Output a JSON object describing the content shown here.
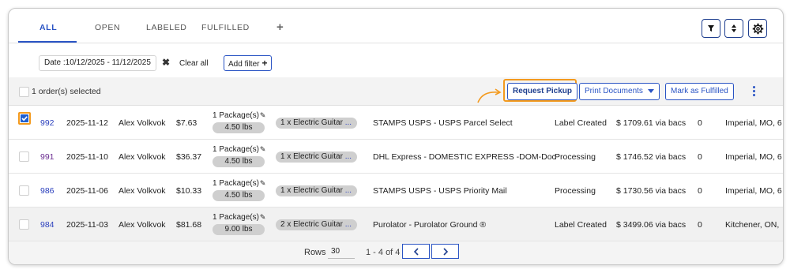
{
  "tabs": [
    {
      "label": "ALL"
    },
    {
      "label": "OPEN"
    },
    {
      "label": "LABELED"
    },
    {
      "label": "FULFILLED"
    }
  ],
  "tab_add": "+",
  "filters": {
    "date_chip": "Date :10/12/2025 - 11/12/2025",
    "clear_all": "Clear all",
    "add_filter": "Add filter"
  },
  "toolbar": {
    "selection_text": "1 order(s) selected",
    "request_pickup": "Request Pickup",
    "print_documents": "Print Documents",
    "mark_fulfilled": "Mark as Fulfilled"
  },
  "orders": [
    {
      "id": "992",
      "date": "2025-11-12",
      "customer": "Alex Volkvok",
      "amount": "$7.63",
      "packages": "1 Package(s)",
      "weight": "4.50 lbs",
      "items": "1 x Electric Guitar",
      "service": "STAMPS USPS - USPS Parcel Select",
      "status": "Label Created",
      "paid": "$ 1709.61 via bacs",
      "count": "0",
      "location": "Imperial, MO, 6"
    },
    {
      "id": "991",
      "date": "2025-11-10",
      "customer": "Alex Volkvok",
      "amount": "$36.37",
      "packages": "1 Package(s)",
      "weight": "4.50 lbs",
      "items": "1 x Electric Guitar",
      "service": "DHL Express - DOMESTIC EXPRESS -DOM-Doc",
      "status": "Processing",
      "paid": "$ 1746.52 via bacs",
      "count": "0",
      "location": "Imperial, MO, 6"
    },
    {
      "id": "986",
      "date": "2025-11-06",
      "customer": "Alex Volkvok",
      "amount": "$10.33",
      "packages": "1 Package(s)",
      "weight": "4.50 lbs",
      "items": "1 x Electric Guitar",
      "service": "STAMPS USPS - USPS Priority Mail",
      "status": "Processing",
      "paid": "$ 1730.56 via bacs",
      "count": "0",
      "location": "Imperial, MO, 6"
    },
    {
      "id": "984",
      "date": "2025-11-03",
      "customer": "Alex Volkvok",
      "amount": "$81.68",
      "packages": "1 Package(s)",
      "weight": "9.00 lbs",
      "items": "2 x Electric Guitar",
      "service": "Purolator - Purolator Ground ®",
      "status": "Label Created",
      "paid": "$ 3499.06 via bacs",
      "count": "0",
      "location": "Kitchener, ON,"
    }
  ],
  "pagination": {
    "rows_label": "Rows",
    "rows_value": "30",
    "range": "1 - 4 of 4"
  },
  "colors": {
    "accent": "#2a54c4",
    "highlight": "#f39a1e",
    "checkbox_fill": "#1f5fd0"
  },
  "icons": [
    "filter-icon",
    "sort-icon",
    "gear-icon",
    "close-icon",
    "plus-icon",
    "pencil-icon",
    "kebab-icon",
    "chevron-left-icon",
    "chevron-right-icon",
    "checkmark-icon",
    "curved-arrow-icon"
  ]
}
